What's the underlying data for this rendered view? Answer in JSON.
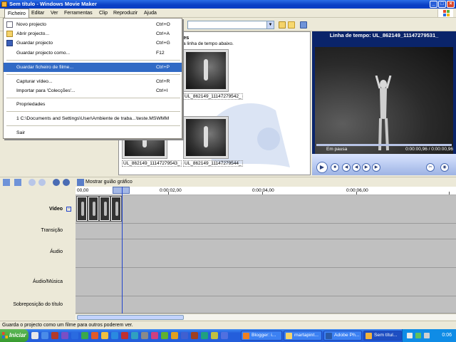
{
  "window": {
    "title": "Sem título - Windows Movie Maker",
    "min": "_",
    "max": "□",
    "close": "×"
  },
  "menubar": [
    "Ficheiro",
    "Editar",
    "Ver",
    "Ferramentas",
    "Clip",
    "Reproduzir",
    "Ajuda"
  ],
  "file_menu": {
    "new_project": {
      "label": "Novo projecto",
      "shortcut": "Ctrl+O"
    },
    "open_project": {
      "label": "Abrir projecto...",
      "shortcut": "Ctrl+A"
    },
    "save_project": {
      "label": "Guardar projecto",
      "shortcut": "Ctrl+G"
    },
    "save_project_as": {
      "label": "Guardar projecto como...",
      "shortcut": "F12"
    },
    "save_movie": {
      "label": "Guardar ficheiro de filme...",
      "shortcut": "Ctrl+P"
    },
    "capture_video": {
      "label": "Capturar vídeo...",
      "shortcut": "Ctrl+R"
    },
    "import": {
      "label": "Importar para 'Colecções'...",
      "shortcut": "Ctrl+I"
    },
    "properties": {
      "label": "Propriedades"
    },
    "recent_file": {
      "label": "1 C:\\Documents and Settings\\User\\Ambiente de traba...\\teste.MSWMM"
    },
    "exit": {
      "label": "Sair"
    }
  },
  "collections": {
    "heading": "es",
    "subheading": "a linha de tempo abaixo.",
    "clips": [
      "UL_862149_11147279542_",
      "UL_862149_11147279543_",
      "UL_862149_11147279544_"
    ]
  },
  "preview": {
    "title": "Linha de tempo: UL_862149_11147279531_",
    "status": "Em pausa",
    "time": "0:00:00,96 / 0:00:00,96"
  },
  "timeline_toolbar": {
    "storyboard": "Mostrar guião gráfico"
  },
  "ruler": [
    "00,00",
    "0:00:02,00",
    "0:00:04,00",
    "0:00:06,00"
  ],
  "tracks": {
    "video": "Vídeo",
    "transition": "Transição",
    "audio": "Áudio",
    "audio_music": "Áudio/Música",
    "title_overlay": "Sobreposição do título"
  },
  "statusbar": "Guarda o projecto como um filme para outros poderem ver.",
  "taskbar": {
    "start": "Iniciar",
    "tasks": [
      "Blogger: i...",
      "martapint...",
      "Adobe Ph...",
      "Sem títul..."
    ],
    "clock": "0:06"
  },
  "colors": {
    "title_bar": "#0a3fc4",
    "menu_highlight": "#316ac5",
    "preview_bg": "#0a246a",
    "taskbar": "#245edb",
    "start_green": "#379b2e"
  }
}
